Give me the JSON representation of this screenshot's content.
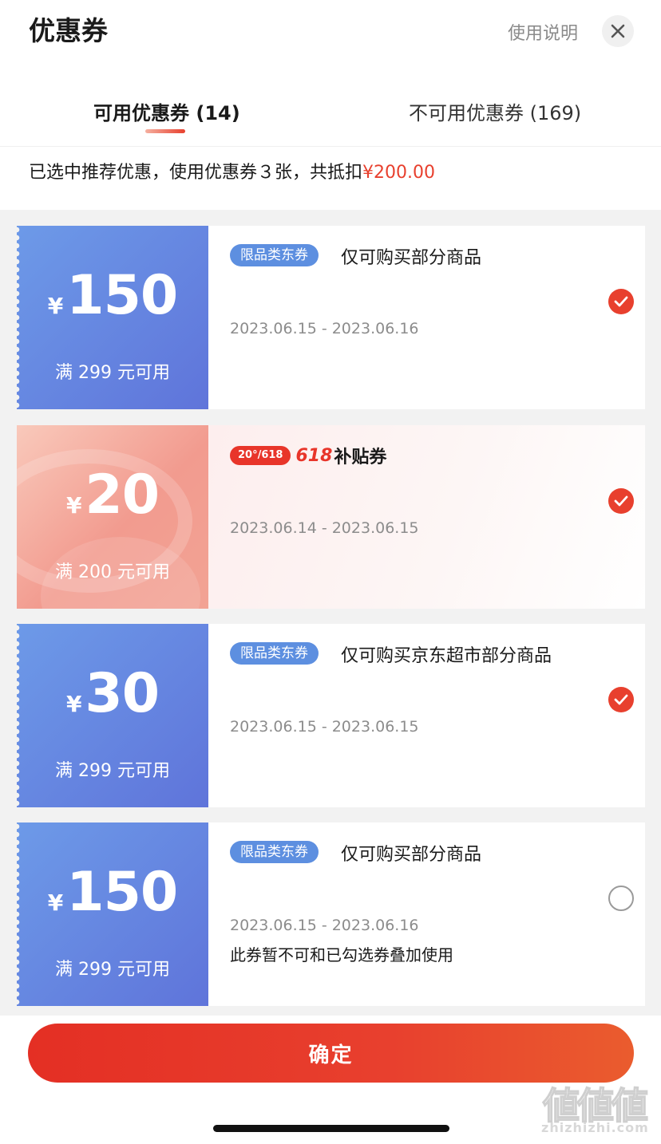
{
  "header": {
    "title": "优惠券",
    "help_label": "使用说明",
    "close_icon": "close-icon"
  },
  "tabs": [
    {
      "label": "可用优惠券 (14)",
      "active": true
    },
    {
      "label": "不可用优惠券 (169)",
      "active": false
    }
  ],
  "summary": {
    "text": "已选中推荐优惠，使用优惠券３张，共抵扣",
    "amount": "¥200.00"
  },
  "coupons": [
    {
      "currency": "¥",
      "value": "150",
      "condition": "满 299 元可用",
      "tag": "限品类东券",
      "description": "仅可购买部分商品",
      "date_range": "2023.06.15 - 2023.06.16",
      "selected": true,
      "style": "blue"
    },
    {
      "currency": "¥",
      "value": "20",
      "condition": "满 200 元可用",
      "badge_pill": "20°/618",
      "badge_number": "618",
      "badge_text": "补贴券",
      "date_range": "2023.06.14 - 2023.06.15",
      "selected": true,
      "style": "pink"
    },
    {
      "currency": "¥",
      "value": "30",
      "condition": "满 299 元可用",
      "tag": "限品类东券",
      "description": "仅可购买京东超市部分商品",
      "date_range": "2023.06.15 - 2023.06.15",
      "selected": true,
      "style": "blue"
    },
    {
      "currency": "¥",
      "value": "150",
      "condition": "满 299 元可用",
      "tag": "限品类东券",
      "description": "仅可购买部分商品",
      "date_range": "2023.06.15 - 2023.06.16",
      "warning": "此券暂不可和已勾选券叠加使用",
      "selected": false,
      "style": "blue"
    }
  ],
  "footer": {
    "confirm_label": "确定"
  },
  "watermark": {
    "logo": "値値値",
    "url": "zhizhizhi.com"
  },
  "colors": {
    "accent": "#e8402e",
    "coupon_blue": "#5f74da",
    "tag_blue": "#5d8fe0"
  }
}
